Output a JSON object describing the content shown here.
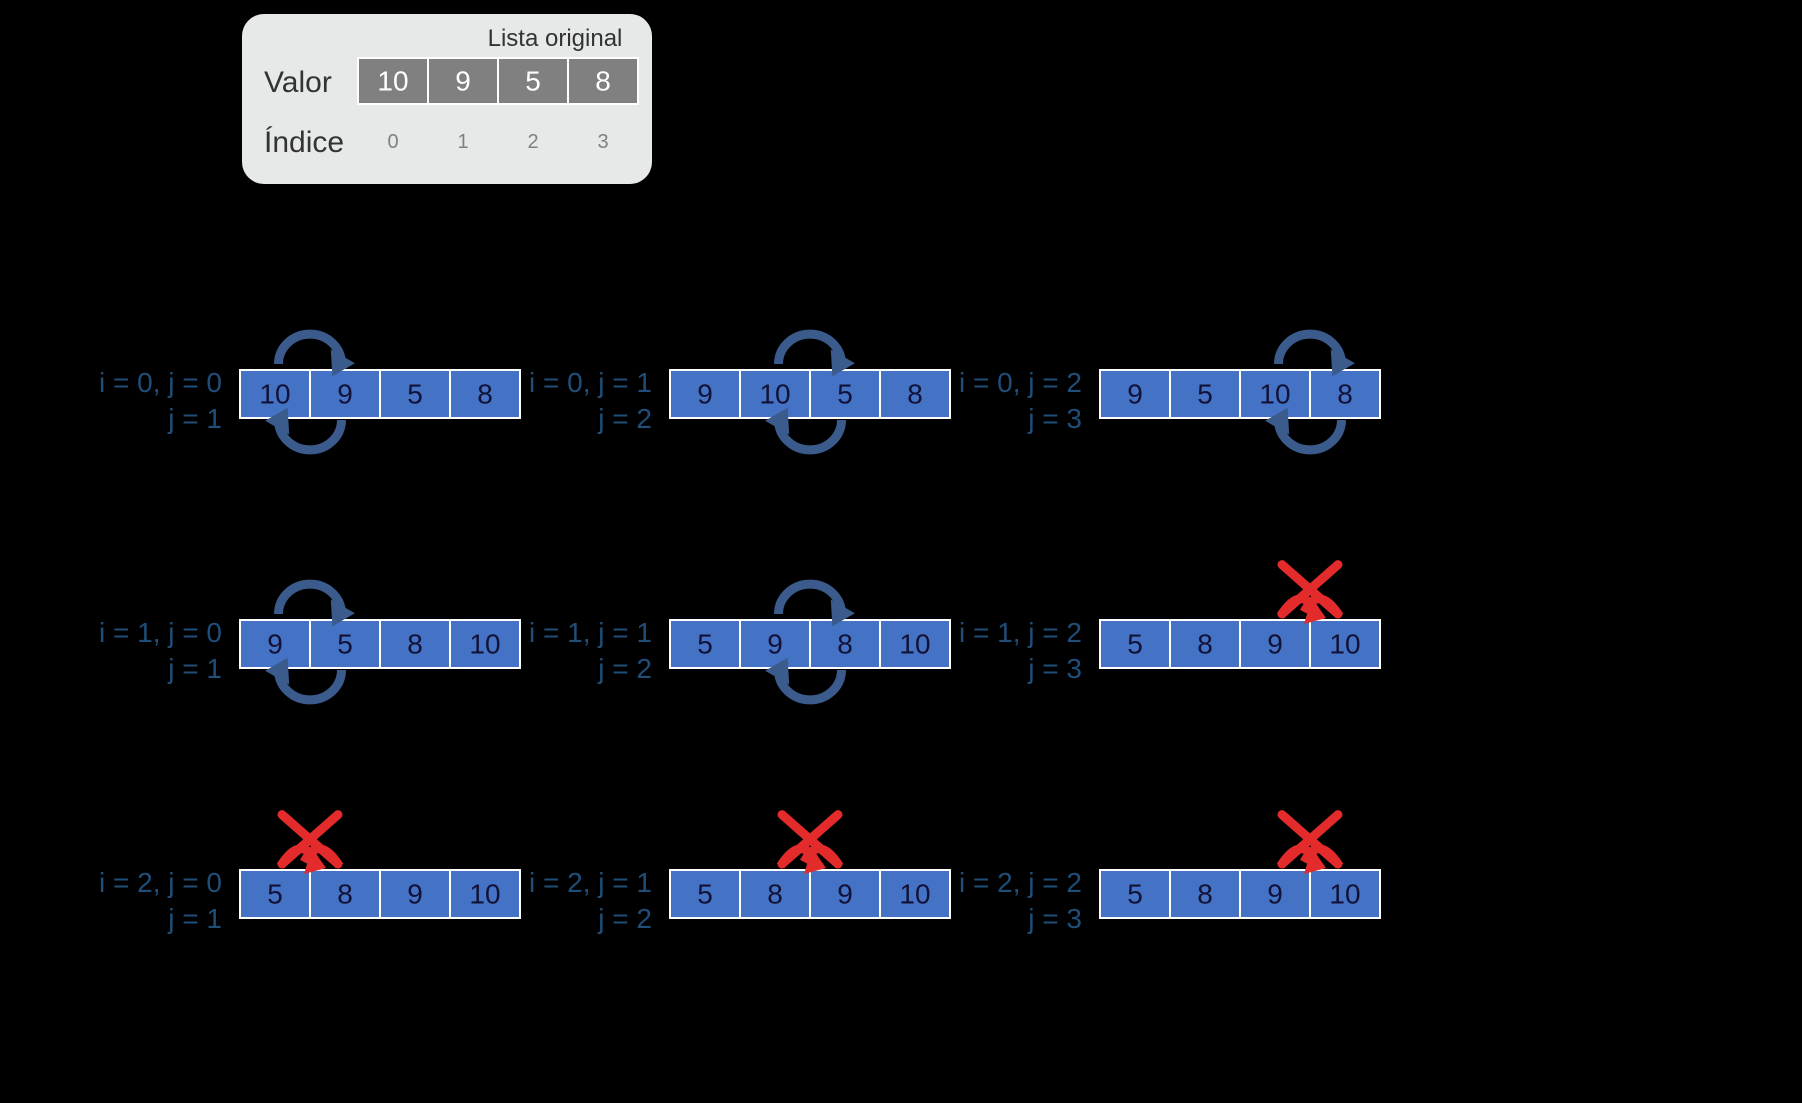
{
  "legend": {
    "title": "Lista original",
    "row_value": "Valor",
    "row_index": "Índice",
    "values": [
      "10",
      "9",
      "5",
      "8"
    ],
    "indices": [
      "0",
      "1",
      "2",
      "3"
    ]
  },
  "steps": [
    {
      "line1": "i = 0, j = 0",
      "line2": "j = 1",
      "cells": [
        "10",
        "9",
        "5",
        "8"
      ],
      "swap": true,
      "pos": 0
    },
    {
      "line1": "i = 0, j = 1",
      "line2": "j = 2",
      "cells": [
        "9",
        "10",
        "5",
        "8"
      ],
      "swap": true,
      "pos": 1
    },
    {
      "line1": "i = 0, j = 2",
      "line2": "j = 3",
      "cells": [
        "9",
        "5",
        "10",
        "8"
      ],
      "swap": true,
      "pos": 2
    },
    {
      "line1": "i = 1, j = 0",
      "line2": "j = 1",
      "cells": [
        "9",
        "5",
        "8",
        "10"
      ],
      "swap": true,
      "pos": 0
    },
    {
      "line1": "i = 1, j = 1",
      "line2": "j = 2",
      "cells": [
        "5",
        "9",
        "8",
        "10"
      ],
      "swap": true,
      "pos": 1
    },
    {
      "line1": "i = 1, j = 2",
      "line2": "j = 3",
      "cells": [
        "5",
        "8",
        "9",
        "10"
      ],
      "swap": false,
      "pos": 2
    },
    {
      "line1": "i = 2, j = 0",
      "line2": "j = 1",
      "cells": [
        "5",
        "8",
        "9",
        "10"
      ],
      "swap": false,
      "pos": 0
    },
    {
      "line1": "i = 2, j = 1",
      "line2": "j = 2",
      "cells": [
        "5",
        "8",
        "9",
        "10"
      ],
      "swap": false,
      "pos": 1
    },
    {
      "line1": "i = 2, j = 2",
      "line2": "j = 3",
      "cells": [
        "5",
        "8",
        "9",
        "10"
      ],
      "swap": false,
      "pos": 2
    }
  ],
  "chart_data": {
    "type": "table",
    "description": "Bubble sort trace over 4-element array",
    "initial": [
      10,
      9,
      5,
      8
    ],
    "iterations": [
      {
        "i": 0,
        "j": 0,
        "compare_with": 1,
        "array": [
          10,
          9,
          5,
          8
        ],
        "swapped": true
      },
      {
        "i": 0,
        "j": 1,
        "compare_with": 2,
        "array": [
          9,
          10,
          5,
          8
        ],
        "swapped": true
      },
      {
        "i": 0,
        "j": 2,
        "compare_with": 3,
        "array": [
          9,
          5,
          10,
          8
        ],
        "swapped": true
      },
      {
        "i": 1,
        "j": 0,
        "compare_with": 1,
        "array": [
          9,
          5,
          8,
          10
        ],
        "swapped": true
      },
      {
        "i": 1,
        "j": 1,
        "compare_with": 2,
        "array": [
          5,
          9,
          8,
          10
        ],
        "swapped": true
      },
      {
        "i": 1,
        "j": 2,
        "compare_with": 3,
        "array": [
          5,
          8,
          9,
          10
        ],
        "swapped": false
      },
      {
        "i": 2,
        "j": 0,
        "compare_with": 1,
        "array": [
          5,
          8,
          9,
          10
        ],
        "swapped": false
      },
      {
        "i": 2,
        "j": 1,
        "compare_with": 2,
        "array": [
          5,
          8,
          9,
          10
        ],
        "swapped": false
      },
      {
        "i": 2,
        "j": 2,
        "compare_with": 3,
        "array": [
          5,
          8,
          9,
          10
        ],
        "swapped": false
      }
    ],
    "final": [
      5,
      8,
      9,
      10
    ]
  }
}
